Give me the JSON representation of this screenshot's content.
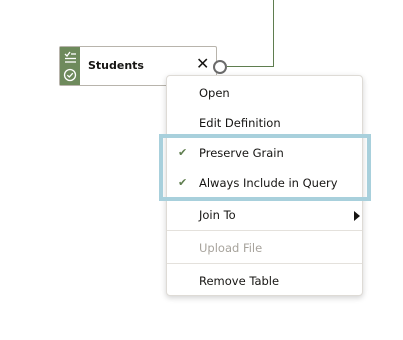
{
  "node": {
    "title": "Students",
    "close_glyph": "✕"
  },
  "icons": [
    "filter-list-icon",
    "checkmark-circle-icon",
    "close-icon",
    "check-icon",
    "submenu-arrow-icon"
  ],
  "colors": {
    "accent_green": "#6e8a5c",
    "highlight": "#a8d0dc"
  },
  "menu": {
    "open": "Open",
    "edit_definition": "Edit Definition",
    "preserve_grain": "Preserve Grain",
    "always_include": "Always Include in Query",
    "join_to": "Join To",
    "upload_file": "Upload File",
    "remove_table": "Remove Table"
  }
}
